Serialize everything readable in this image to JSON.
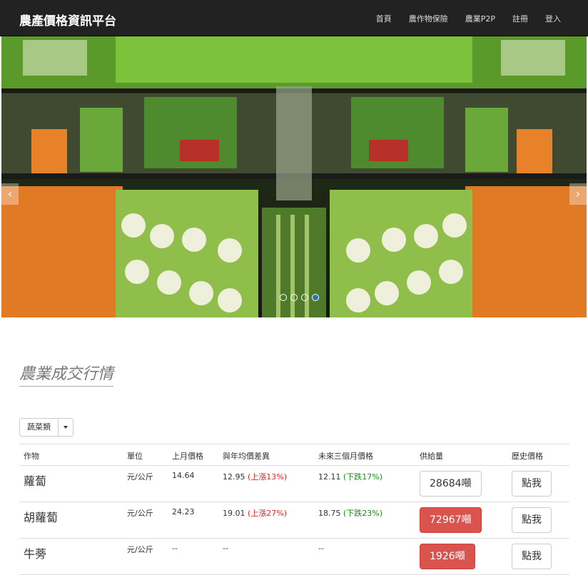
{
  "navbar": {
    "brand": "農產價格資訊平台",
    "links": [
      "首頁",
      "農作物保險",
      "農業P2P",
      "註冊",
      "登入"
    ]
  },
  "carousel": {
    "prev_icon": "chevron-left-icon",
    "next_icon": "chevron-right-icon",
    "prev_glyph": "‹",
    "next_glyph": "›",
    "slide_count": 4,
    "active_index": 3
  },
  "section": {
    "title": "農業成交行情"
  },
  "filter": {
    "selected": "蔬菜類"
  },
  "table": {
    "headers": [
      "作物",
      "單位",
      "上月價格",
      "與年均價差異",
      "未來三個月價格",
      "供給量",
      "歷史價格"
    ],
    "rows": [
      {
        "crop": "蘿蔔",
        "unit": "元/公斤",
        "last_month": "14.64",
        "annual_value": "12.95",
        "annual_change": "(上漲13%)",
        "annual_dir": "up",
        "forecast_value": "12.11",
        "forecast_change": "(下跌17%)",
        "forecast_dir": "down",
        "supply": "28684噸",
        "supply_style": "default",
        "history": "點我"
      },
      {
        "crop": "胡蘿蔔",
        "unit": "元/公斤",
        "last_month": "24.23",
        "annual_value": "19.01",
        "annual_change": "(上漲27%)",
        "annual_dir": "up",
        "forecast_value": "18.75",
        "forecast_change": "(下跌23%)",
        "forecast_dir": "down",
        "supply": "72967噸",
        "supply_style": "danger",
        "history": "點我"
      },
      {
        "crop": "牛蒡",
        "unit": "元/公斤",
        "last_month": "--",
        "annual_value": "--",
        "annual_change": "",
        "annual_dir": "",
        "forecast_value": "--",
        "forecast_change": "",
        "forecast_dir": "",
        "supply": "1926噸",
        "supply_style": "danger",
        "history": "點我"
      }
    ]
  },
  "colors": {
    "navbar": "#222222",
    "danger": "#d9534f",
    "up": "#d9262a",
    "down": "#1a8a1a",
    "indicator_active": "#2f6fb4"
  }
}
